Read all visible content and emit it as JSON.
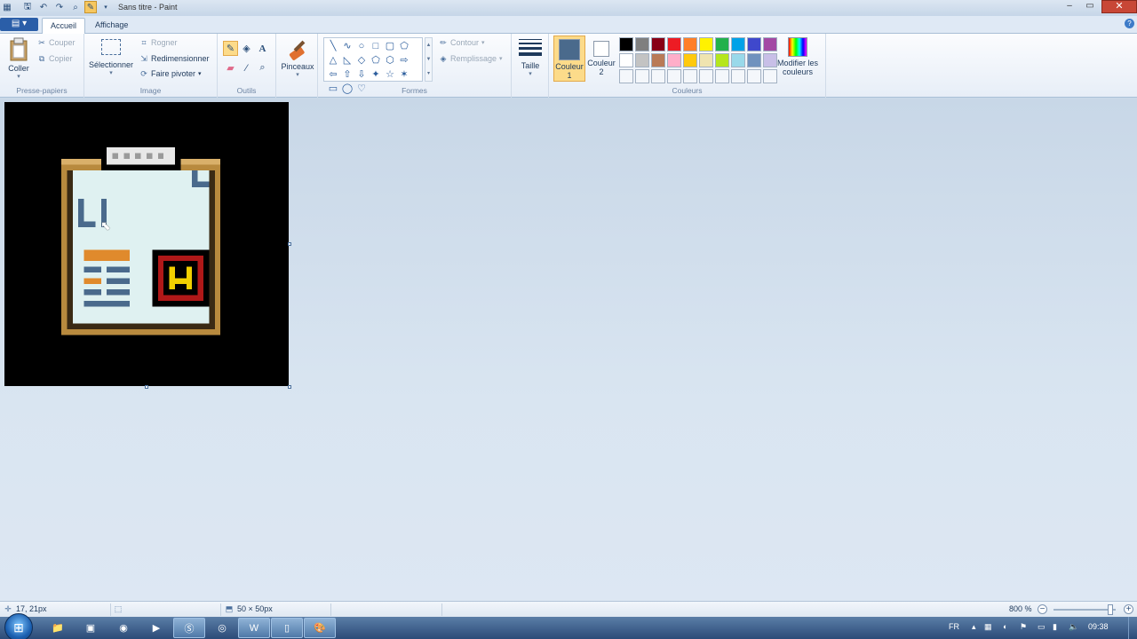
{
  "window": {
    "title": "Sans titre - Paint",
    "controls": {
      "minimize": "–",
      "maximize": "▭",
      "close": "✕"
    }
  },
  "quick_access": [
    "paint-app-icon",
    "save-icon",
    "undo-icon",
    "redo-icon",
    "magnifier-icon",
    "pencil-icon",
    "dropdown-icon"
  ],
  "menu": {
    "file_label": "▤ ▾",
    "tabs": [
      "Accueil",
      "Affichage"
    ],
    "active_tab": "Accueil",
    "help": "?"
  },
  "ribbon": {
    "clipboard": {
      "label": "Presse-papiers",
      "paste": "Coller",
      "cut": "Couper",
      "copy": "Copier"
    },
    "image": {
      "label": "Image",
      "select": "Sélectionner",
      "crop": "Rogner",
      "resize": "Redimensionner",
      "rotate": "Faire pivoter"
    },
    "tools": {
      "label": "Outils",
      "items": [
        "pencil-icon",
        "fill-bucket-icon",
        "text-icon",
        "eraser-icon",
        "color-picker-icon",
        "magnifier-icon"
      ],
      "selected": "pencil-icon"
    },
    "brushes": {
      "label": "Pinceaux"
    },
    "shapes": {
      "label": "Formes",
      "glyphs": [
        "╲",
        "∿",
        "○",
        "□",
        "▢",
        "⬠",
        "△",
        "◺",
        "◇",
        "⬠",
        "⬡",
        "⇨",
        "⇦",
        "⇧",
        "⇩",
        "✦",
        "☆",
        "✶",
        "▭",
        "◯",
        "♡"
      ],
      "outline": "Contour",
      "fill": "Remplissage"
    },
    "size": {
      "label": "Taille"
    },
    "colors": {
      "label": "Couleurs",
      "color1": "Couleur 1",
      "color2": "Couleur 2",
      "color1_value": "#4a6a8c",
      "color2_value": "#ffffff",
      "edit": "Modifier les couleurs",
      "palette": [
        "#000000",
        "#7f7f7f",
        "#880015",
        "#ed1c24",
        "#ff7f27",
        "#fff200",
        "#22b14c",
        "#00a2e8",
        "#3f48cc",
        "#a349a4",
        "#ffffff",
        "#c3c3c3",
        "#b97a57",
        "#ffaec9",
        "#ffc90e",
        "#efe4b0",
        "#b5e61d",
        "#99d9ea",
        "#7092be",
        "#c8bfe7",
        "#f4f7fb",
        "#f4f7fb",
        "#f4f7fb",
        "#f4f7fb",
        "#f4f7fb",
        "#f4f7fb",
        "#f4f7fb",
        "#f4f7fb",
        "#f4f7fb",
        "#f4f7fb"
      ]
    }
  },
  "canvas": {
    "pixel_art_colors": {
      "background": "#000000",
      "board": "#dff1f1",
      "frame": "#b88a3e",
      "clip": "#e8e8e8",
      "text": "#4a6a8c",
      "orange": "#e08a2c",
      "red": "#b01818",
      "yellow": "#f2d000"
    },
    "pixel_text": "L I"
  },
  "status": {
    "cursor_pos": "17, 21px",
    "selection_size": "",
    "image_size": "50 × 50px",
    "zoom": "800 %"
  },
  "taskbar": {
    "apps": [
      "explorer-icon",
      "window-icon",
      "firefox-icon",
      "media-player-icon",
      "skype-icon",
      "chrome-icon",
      "word-icon",
      "notepad-icon",
      "paint-icon"
    ],
    "active_app": "paint-icon",
    "language": "FR",
    "time": "09:38"
  }
}
